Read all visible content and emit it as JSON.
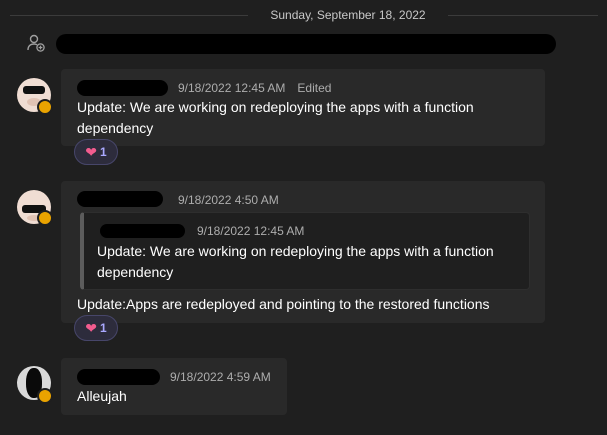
{
  "date_divider": "Sunday, September 18, 2022",
  "messages": [
    {
      "timestamp": "9/18/2022 12:45 AM",
      "edited": "Edited",
      "text_lines": [
        "Update: We are working on redeploying the apps with a function",
        "dependency"
      ],
      "reaction": {
        "icon": "heart-icon",
        "count": "1"
      }
    },
    {
      "timestamp": "9/18/2022 4:50 AM",
      "quote": {
        "timestamp": "9/18/2022 12:45 AM",
        "text_lines": [
          "Update: We are working on redeploying the apps with a function",
          "dependency"
        ]
      },
      "text": "Update:Apps are redeployed and pointing to the restored functions",
      "reaction": {
        "icon": "heart-icon",
        "count": "1"
      }
    },
    {
      "timestamp": "9/18/2022 4:59 AM",
      "text": "Alleujah"
    }
  ],
  "colors": {
    "background": "#1f1f1f",
    "bubble": "#292929",
    "status_away": "#eaa300",
    "reaction_count": "#aaa9ff",
    "heart": "#f25c8f"
  }
}
